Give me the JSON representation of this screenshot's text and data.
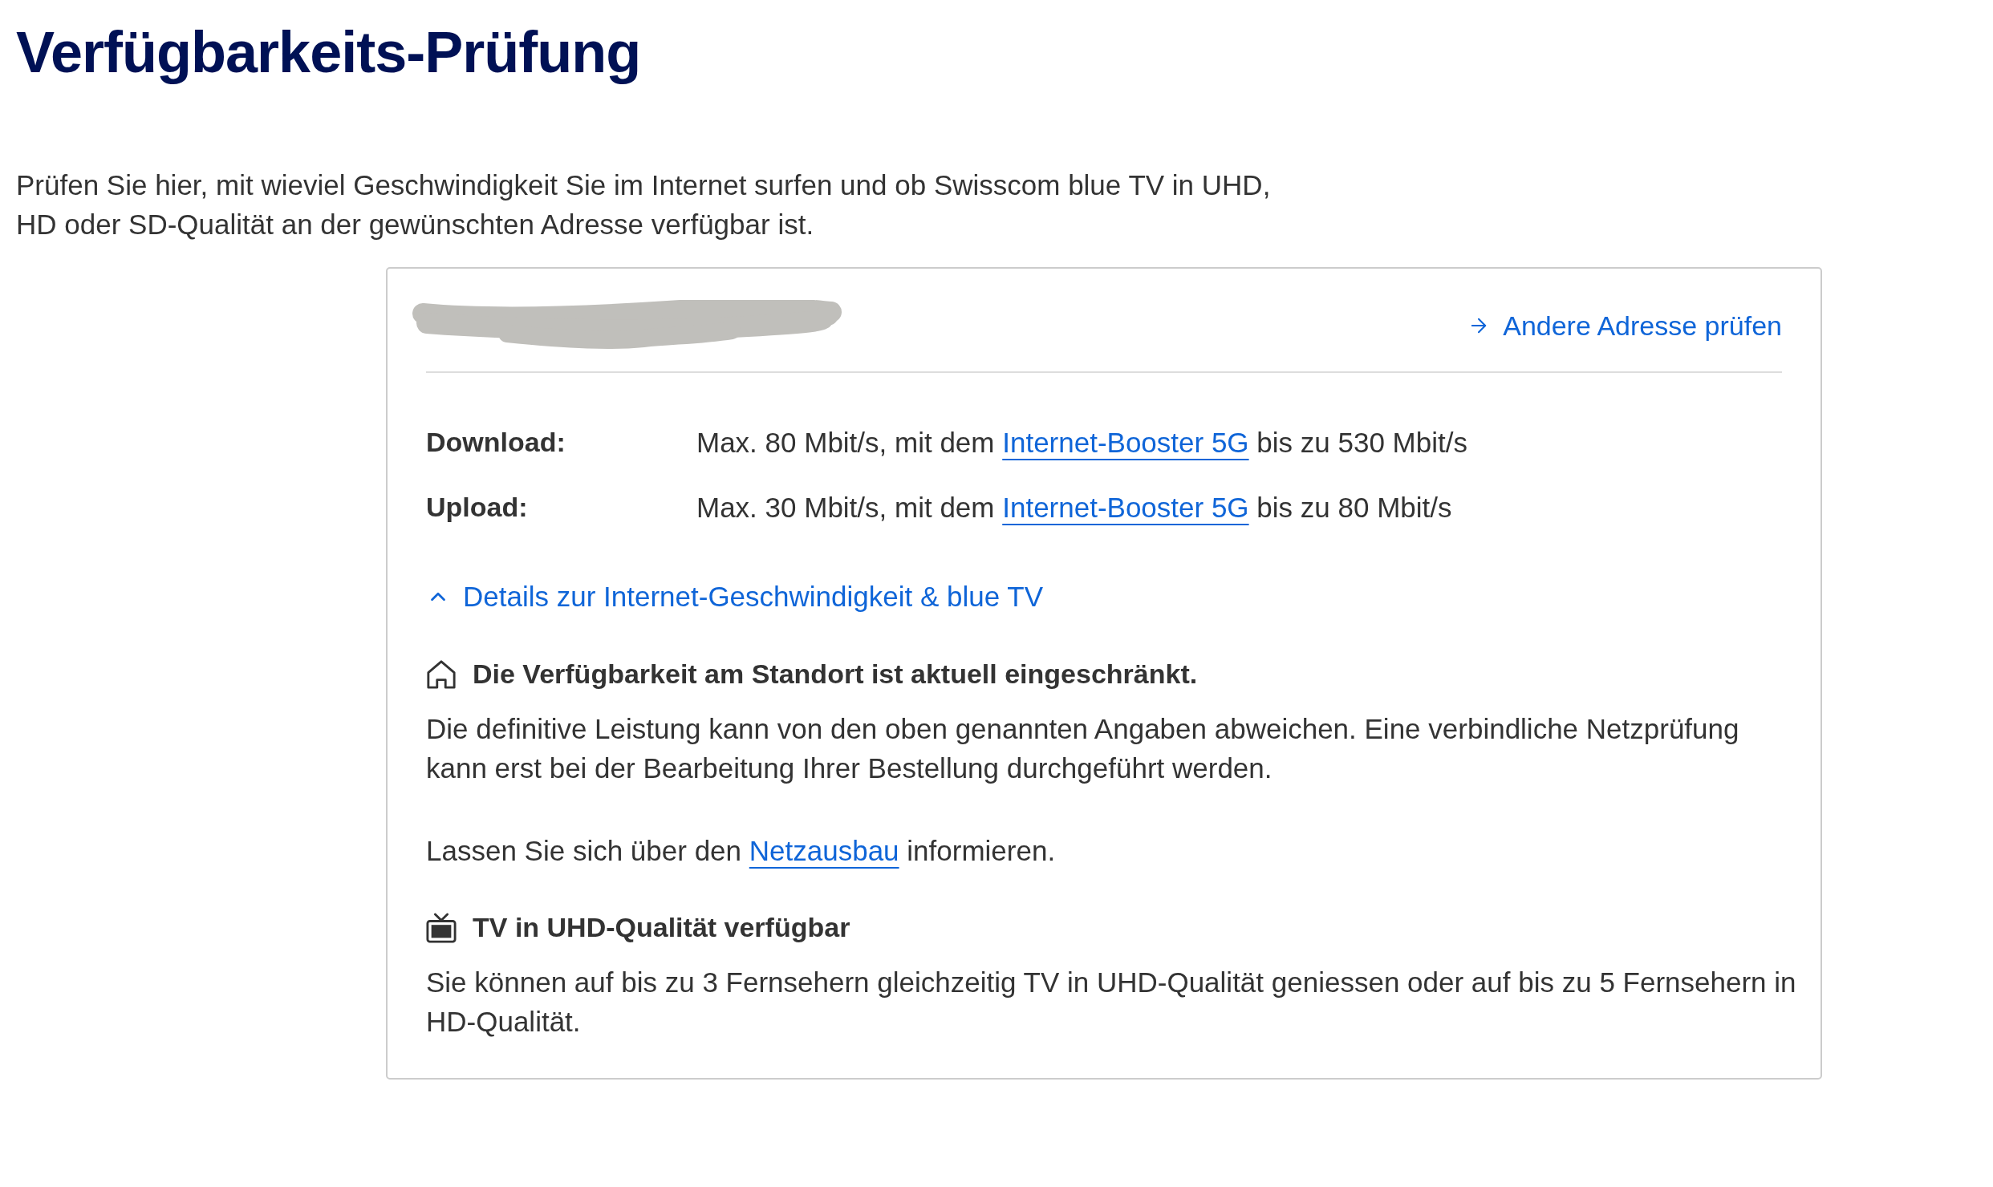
{
  "page_title": "Verfügbarkeits-Prüfung",
  "intro": "Prüfen Sie hier, mit wieviel Geschwindigkeit Sie im Internet surfen und ob Swisscom blue TV in UHD, HD oder SD-Qualität an der gewünschten Adresse verfügbar ist.",
  "result_card": {
    "change_address_link": "Andere Adresse prüfen",
    "speeds": [
      {
        "label": "Download:",
        "value": [
          {
            "kind": "text",
            "text": "Max. 80 Mbit/s, mit dem"
          },
          {
            "kind": "link",
            "text": "Internet-Booster 5G"
          },
          {
            "kind": "text",
            "text": "bis zu 530 Mbit/s"
          }
        ]
      },
      {
        "label": "Upload:",
        "value": [
          {
            "kind": "text",
            "text": "Max. 30 Mbit/s, mit dem"
          },
          {
            "kind": "link",
            "text": "Internet-Booster 5G"
          },
          {
            "kind": "text",
            "text": "bis zu 80 Mbit/s"
          }
        ]
      }
    ],
    "details": {
      "label": "Details zur Internet-Geschwindigkeit & blue TV",
      "expanded": true,
      "notices": [
        {
          "kind": "location",
          "heading": "Die Verfügbarkeit am Standort ist aktuell eingeschränkt.",
          "paragraphs": [
            [
              {
                "kind": "text",
                "text": "Die definitive Leistung kann von den oben genannten Angaben abweichen. Eine verbindliche Netzprüfung kann erst bei der Bearbeitung Ihrer Bestellung durchgeführt werden."
              }
            ],
            [
              {
                "kind": "text",
                "text": "Lassen Sie sich über den"
              },
              {
                "kind": "link",
                "text": "Netzausbau"
              },
              {
                "kind": "text",
                "text": "informieren."
              }
            ]
          ]
        },
        {
          "kind": "tv",
          "heading": "TV in UHD-Qualität verfügbar",
          "paragraphs": [
            [
              {
                "kind": "text",
                "text": "Sie können auf bis zu 3 Fernsehern gleichzeitig TV in UHD-Qualität geniessen oder auf bis zu 5 Fernsehern in HD-Qualität."
              }
            ]
          ]
        }
      ]
    }
  }
}
